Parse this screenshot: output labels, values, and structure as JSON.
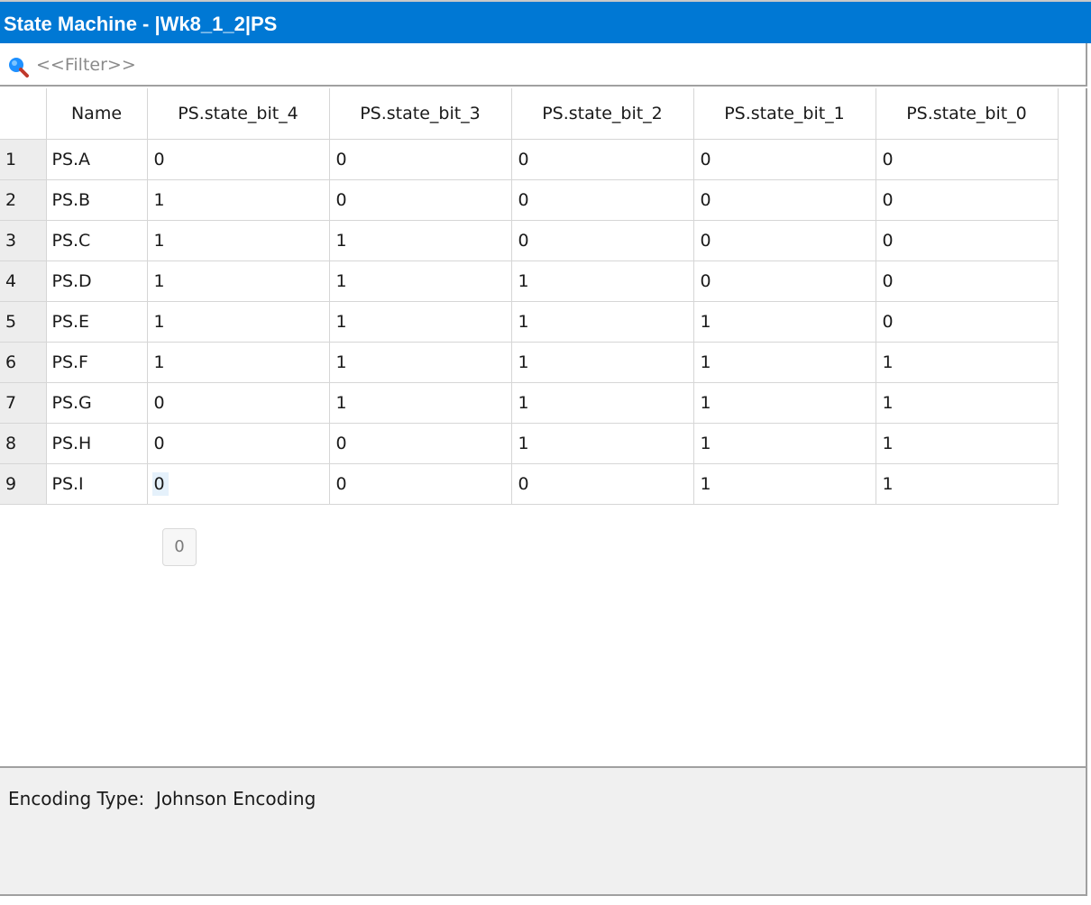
{
  "window": {
    "title": "State Machine - |Wk8_1_2|PS"
  },
  "filter": {
    "placeholder": "<<Filter>>",
    "value": ""
  },
  "icons": {
    "search": "search-icon"
  },
  "colors": {
    "titlebar": "#0078d4",
    "rownum_bg": "#ededed",
    "selected_cell": "#e5f1fb",
    "info_panel_bg": "#f0f0f0"
  },
  "table": {
    "columns": [
      "Name",
      "PS.state_bit_4",
      "PS.state_bit_3",
      "PS.state_bit_2",
      "PS.state_bit_1",
      "PS.state_bit_0"
    ],
    "rows": [
      {
        "num": "1",
        "cells": [
          "PS.A",
          "0",
          "0",
          "0",
          "0",
          "0"
        ]
      },
      {
        "num": "2",
        "cells": [
          "PS.B",
          "1",
          "0",
          "0",
          "0",
          "0"
        ]
      },
      {
        "num": "3",
        "cells": [
          "PS.C",
          "1",
          "1",
          "0",
          "0",
          "0"
        ]
      },
      {
        "num": "4",
        "cells": [
          "PS.D",
          "1",
          "1",
          "1",
          "0",
          "0"
        ]
      },
      {
        "num": "5",
        "cells": [
          "PS.E",
          "1",
          "1",
          "1",
          "1",
          "0"
        ]
      },
      {
        "num": "6",
        "cells": [
          "PS.F",
          "1",
          "1",
          "1",
          "1",
          "1"
        ]
      },
      {
        "num": "7",
        "cells": [
          "PS.G",
          "0",
          "1",
          "1",
          "1",
          "1"
        ]
      },
      {
        "num": "8",
        "cells": [
          "PS.H",
          "0",
          "0",
          "1",
          "1",
          "1"
        ]
      },
      {
        "num": "9",
        "cells": [
          "PS.I",
          "0",
          "0",
          "0",
          "1",
          "1"
        ]
      }
    ],
    "selected": {
      "row": 8,
      "col": 1
    }
  },
  "tooltip": {
    "text": "0"
  },
  "info": {
    "encoding_label": "Encoding Type:",
    "encoding_value": "Johnson Encoding"
  }
}
